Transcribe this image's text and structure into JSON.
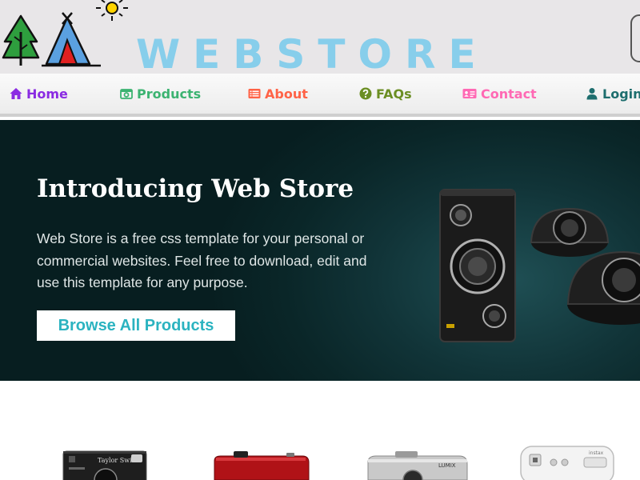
{
  "site": {
    "title": "WEBSTORE"
  },
  "nav": {
    "items": [
      {
        "label": "Home",
        "icon": "home-icon",
        "color": "#8a2be2"
      },
      {
        "label": "Products",
        "icon": "camera-icon",
        "color": "#3cb371"
      },
      {
        "label": "About",
        "icon": "list-icon",
        "color": "#ff6347"
      },
      {
        "label": "FAQs",
        "icon": "question-circle-icon",
        "color": "#6b8e23"
      },
      {
        "label": "Contact",
        "icon": "id-card-icon",
        "color": "#ff69b4"
      },
      {
        "label": "Login",
        "icon": "user-icon",
        "color": "#1e6e6e"
      }
    ]
  },
  "hero": {
    "title": "Introducing Web Store",
    "text": "Web Store is a free css template for your personal or commercial websites. Feel free to download, edit and use this template for any purpose.",
    "button_label": "Browse All Products"
  },
  "products": {
    "camera1_brand": "Taylor Swift",
    "camera3_brand": "LUMIX",
    "camera4_brand": "instax"
  },
  "colors": {
    "title": "#87ceeb",
    "hero_bg": "#0a2628",
    "button_text": "#2bb3c0"
  }
}
